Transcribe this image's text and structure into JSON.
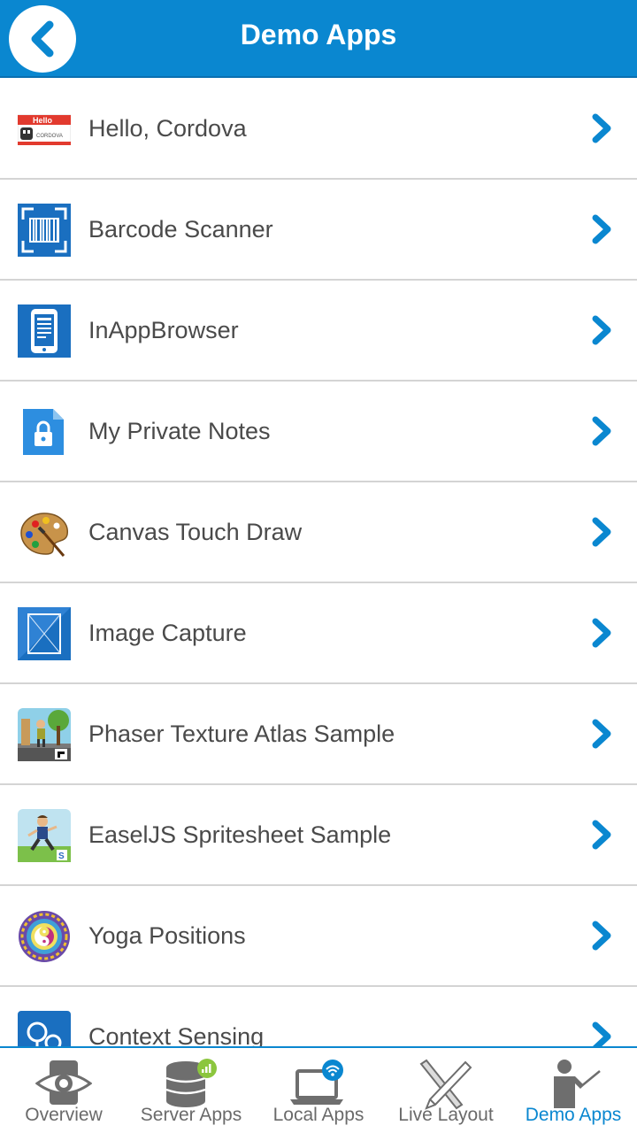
{
  "header": {
    "title": "Demo Apps",
    "back_icon": "chevron-left-icon"
  },
  "list": {
    "items": [
      {
        "label": "Hello, Cordova",
        "icon": "hello-badge-icon"
      },
      {
        "label": "Barcode Scanner",
        "icon": "barcode-icon"
      },
      {
        "label": "InAppBrowser",
        "icon": "phone-browser-icon"
      },
      {
        "label": "My Private Notes",
        "icon": "locked-note-icon"
      },
      {
        "label": "Canvas Touch Draw",
        "icon": "paint-palette-icon"
      },
      {
        "label": "Image Capture",
        "icon": "image-frame-icon"
      },
      {
        "label": "Phaser Texture Atlas Sample",
        "icon": "phaser-game-icon"
      },
      {
        "label": "EaselJS Spritesheet Sample",
        "icon": "easeljs-runner-icon"
      },
      {
        "label": "Yoga Positions",
        "icon": "yoga-mandala-icon"
      },
      {
        "label": "Context Sensing",
        "icon": "location-pin-icon"
      }
    ],
    "hello_badge": {
      "top": "Hello",
      "bottom": "CORDOVA"
    }
  },
  "tabbar": {
    "tabs": [
      {
        "label": "Overview",
        "icon": "eye-tablet-icon",
        "active": false
      },
      {
        "label": "Server Apps",
        "icon": "database-icon",
        "active": false
      },
      {
        "label": "Local Apps",
        "icon": "laptop-wifi-icon",
        "active": false
      },
      {
        "label": "Live Layout",
        "icon": "pencil-ruler-icon",
        "active": false
      },
      {
        "label": "Demo Apps",
        "icon": "presenter-icon",
        "active": true
      }
    ]
  },
  "colors": {
    "accent": "#0a87d0",
    "text": "#4a4a4a",
    "divider": "#d4d4d4",
    "tab_inactive": "#6a6a6a"
  }
}
